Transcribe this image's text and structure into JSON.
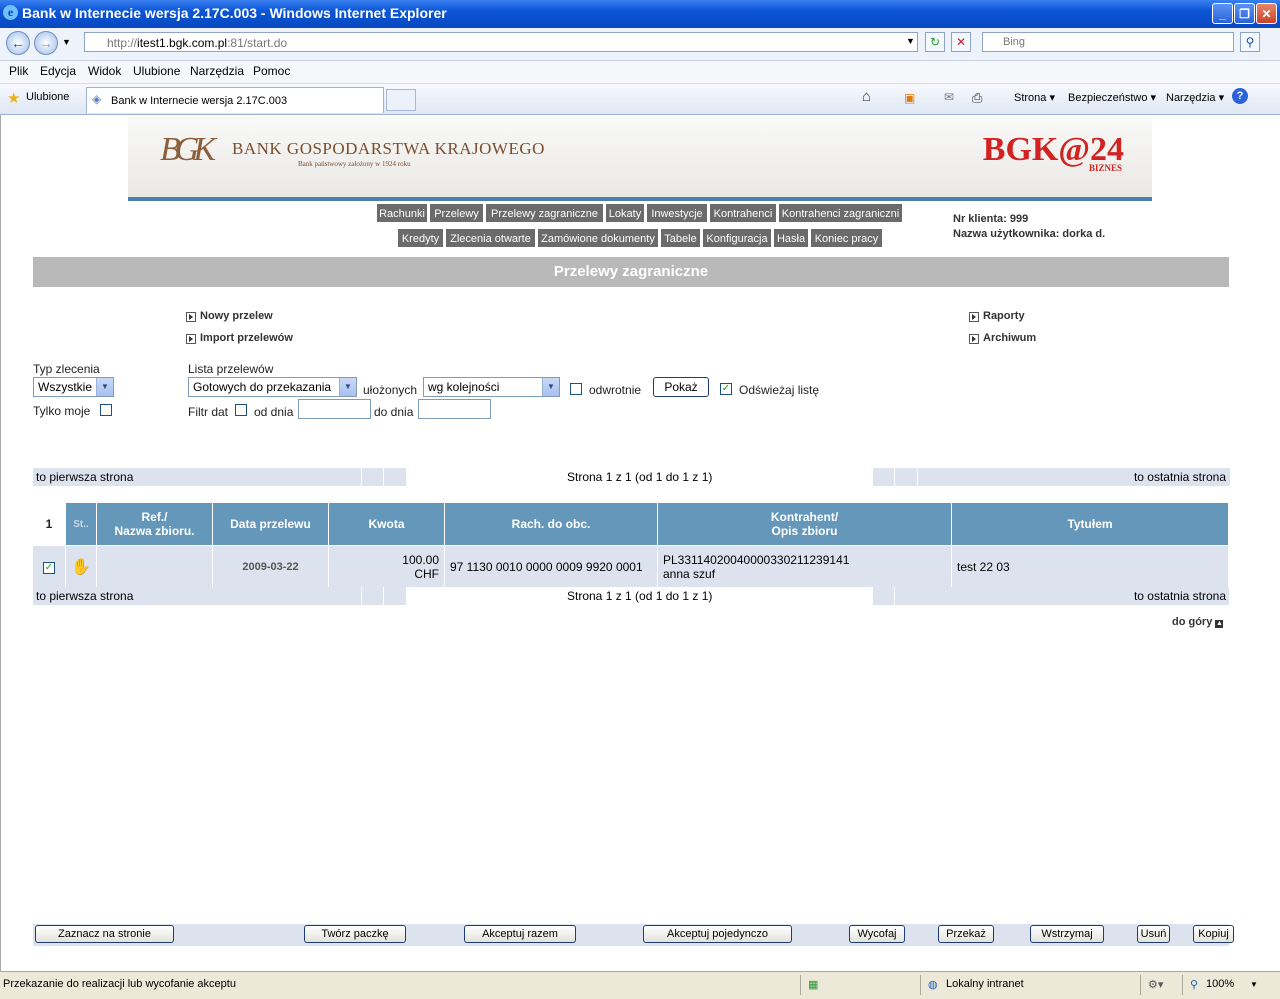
{
  "window": {
    "title": "Bank w Internecie wersja 2.17C.003 - Windows Internet Explorer",
    "url_prefix": "http://",
    "url_host": "itest1.bgk.com.pl",
    "url_rest": ":81/start.do",
    "search_placeholder": "Bing",
    "minimize": "_",
    "maximize": "❐",
    "close": "✕"
  },
  "menu": [
    "Plik",
    "Edycja",
    "Widok",
    "Ulubione",
    "Narzędzia",
    "Pomoc"
  ],
  "favorites_label": "Ulubione",
  "tab_title": "Bank w Internecie wersja 2.17C.003",
  "toolbar": {
    "strona": "Strona ▾",
    "bezpieczenstwo": "Bezpieczeństwo ▾",
    "narzedzia": "Narzędzia ▾"
  },
  "banner": {
    "bank_name": "BANK GOSPODARSTWA KRAJOWEGO",
    "bank_sub": "Bank państwowy założony w 1924 roku",
    "logo_initials": "BGK",
    "product": "BGK@24",
    "product_sub": "BIZNES"
  },
  "nav_row1": [
    "Rachunki",
    "Przelewy",
    "Przelewy zagraniczne",
    "Lokaty",
    "Inwestycje",
    "Kontrahenci",
    "Kontrahenci zagraniczni"
  ],
  "nav_row2": [
    "Kredyty",
    "Zlecenia otwarte",
    "Zamówione dokumenty",
    "Tabele",
    "Konfiguracja",
    "Hasła",
    "Koniec pracy"
  ],
  "client_info": {
    "client_no": "Nr klienta: 999",
    "user": "Nazwa użytkownika: dorka d."
  },
  "section_title": "Przelewy zagraniczne",
  "links": {
    "new": "Nowy przelew",
    "import": "Import przelewów",
    "reports": "Raporty",
    "archive": "Archiwum"
  },
  "filters": {
    "type_label": "Typ zlecenia",
    "type_value": "Wszystkie",
    "only_mine": "Tylko moje",
    "list_label": "Lista przelewów",
    "list_value": "Gotowych do przekazania",
    "sorted_label": "ułożonych",
    "sort_value": "wg kolejności",
    "reverse": "odwrotnie",
    "show_button": "Pokaż",
    "refresh": "Odświeżaj listę",
    "date_filter": "Filtr dat",
    "from_date": "od dnia",
    "to_date": "do dnia"
  },
  "pager": {
    "first": "to pierwsza strona",
    "info": "Strona 1 z 1 (od 1 do 1 z 1)",
    "last": "to ostatnia strona"
  },
  "table": {
    "headers": {
      "num": "1",
      "st": "St..",
      "ref": "Ref./",
      "ref2": "Nazwa zbioru.",
      "date": "Data przelewu",
      "amount": "Kwota",
      "account": "Rach. do obc.",
      "contractor": "Kontrahent/",
      "contractor2": "Opis zbioru",
      "title": "Tytułem"
    },
    "row": {
      "date": "2009-03-22",
      "amount": "100.00",
      "currency": "CHF",
      "account": "97 1130 0010 0000 0009 9920 0001",
      "contractor_account": "PL33114020040000330211239141",
      "contractor_name": "anna szuf",
      "title": "test 22 03"
    }
  },
  "to_top": "do góry",
  "buttons": [
    "Zaznacz na stronie",
    "Twórz paczkę",
    "Akceptuj razem",
    "Akceptuj pojedynczo",
    "Wycofaj",
    "Przekaż",
    "Wstrzymaj",
    "Usuń",
    "Kopiuj"
  ],
  "status": {
    "text": "Przekazanie do realizacji lub wycofanie akceptu",
    "zone": "Lokalny intranet",
    "zoom": "100%"
  }
}
